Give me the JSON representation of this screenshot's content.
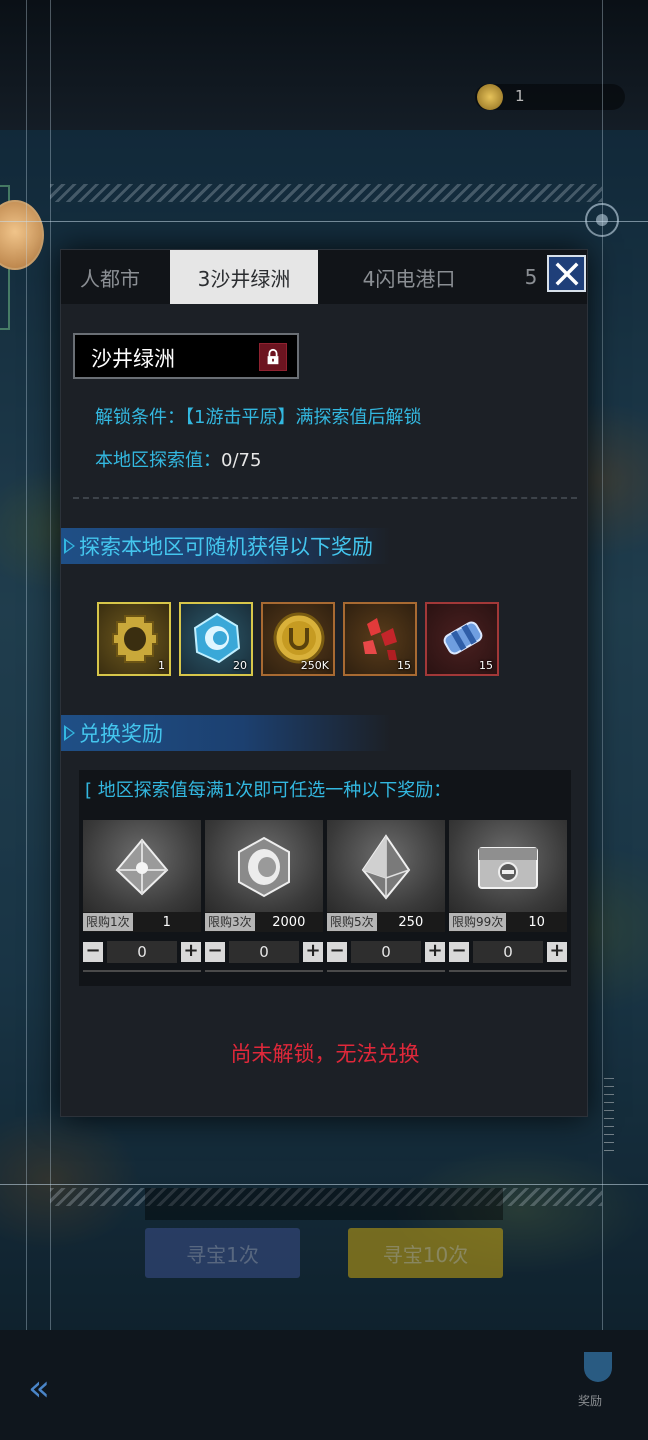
{
  "background": {
    "top_coin_value": "1",
    "buttons": [
      "寻宝1次",
      "寻宝10次"
    ],
    "trophy_label": "奖励"
  },
  "tabs": [
    "人都市",
    "3沙井绿洲",
    "4闪电港口",
    "5"
  ],
  "active_tab_index": 1,
  "region": {
    "name": "沙井绿洲",
    "locked": true,
    "unlock_label": "解锁条件：",
    "unlock_condition": "【1游击平原】满探索值后解锁",
    "explore_label": "本地区探索值：",
    "explore_value": "0/75"
  },
  "random_rewards": {
    "title": "探索本地区可随机获得以下奖励",
    "items": [
      {
        "icon": "gold-gear-icon",
        "qty": "1",
        "frame": "gold"
      },
      {
        "icon": "blue-crystal-egg-icon",
        "qty": "20",
        "frame": "gold"
      },
      {
        "icon": "gold-coin-icon",
        "qty": "250K",
        "frame": "orange"
      },
      {
        "icon": "red-crystal-shards-icon",
        "qty": "15",
        "frame": "orange"
      },
      {
        "icon": "blue-capsule-icon",
        "qty": "15",
        "frame": "red"
      }
    ]
  },
  "exchange": {
    "title": "兑换奖励",
    "note": "[ 地区探索值每满1次即可任选一种以下奖励：",
    "items": [
      {
        "icon": "silver-cube-icon",
        "limit": "限购1次",
        "cost": "1",
        "quantity": "0"
      },
      {
        "icon": "silver-egg-icon",
        "limit": "限购3次",
        "cost": "2000",
        "quantity": "0"
      },
      {
        "icon": "silver-diamond-icon",
        "limit": "限购5次",
        "cost": "250",
        "quantity": "0"
      },
      {
        "icon": "silver-chest-icon",
        "limit": "限购99次",
        "cost": "10",
        "quantity": "0"
      }
    ],
    "minus_symbol": "−",
    "plus_symbol": "+",
    "locked_message": "尚未解锁，无法兑换"
  },
  "colors": {
    "accent": "#33b8e0",
    "warning": "#e0283a",
    "close_bg": "#1f3f79"
  }
}
